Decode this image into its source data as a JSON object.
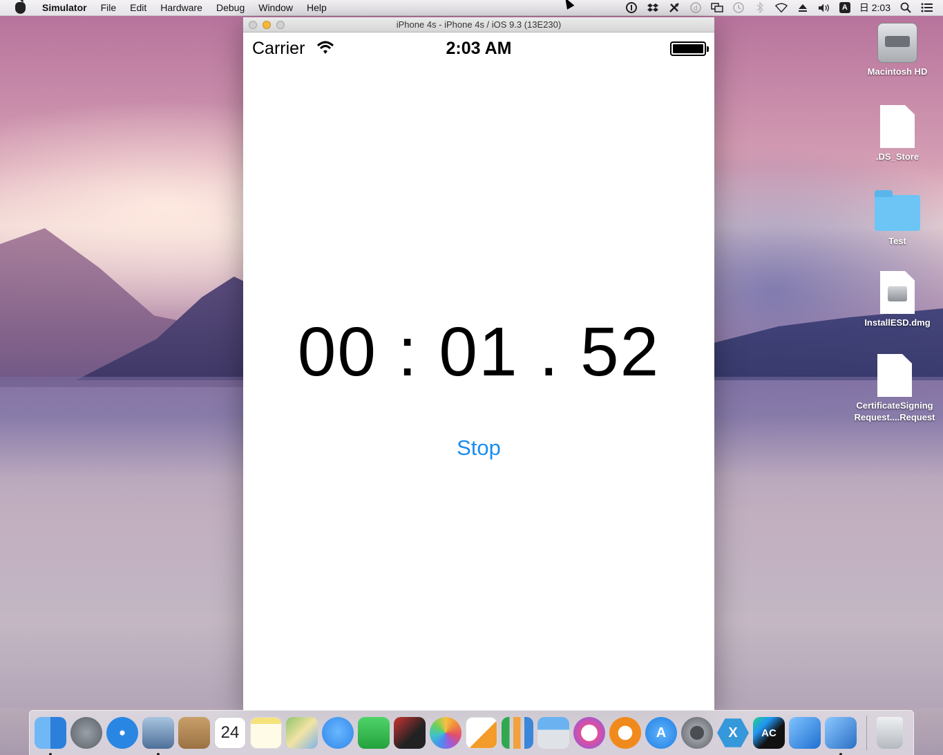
{
  "menubar": {
    "app_name": "Simulator",
    "items": [
      "File",
      "Edit",
      "Hardware",
      "Debug",
      "Window",
      "Help"
    ],
    "input_badge": "A",
    "clock": "日 2:03"
  },
  "simulator": {
    "window_title": "iPhone 4s - iPhone 4s / iOS 9.3 (13E230)"
  },
  "ios": {
    "carrier": "Carrier",
    "time": "2:03 AM",
    "timer": "00 : 01 . 52",
    "stop_label": "Stop"
  },
  "desktop_icons": [
    {
      "label": "Macintosh HD",
      "icon": "hard-drive-icon"
    },
    {
      "label": ".DS_Store",
      "icon": "document-icon"
    },
    {
      "label": "Test",
      "icon": "folder-icon"
    },
    {
      "label": "InstallESD.dmg",
      "icon": "disk-image-icon"
    },
    {
      "label": "CertificateSigning",
      "label2": "Request....Request",
      "icon": "document-icon"
    }
  ],
  "dock": {
    "calendar_day": "24",
    "items": [
      {
        "name": "finder-icon",
        "color": "#3b8ee8",
        "running": true
      },
      {
        "name": "launchpad-icon",
        "color": "#7b7f86",
        "running": false
      },
      {
        "name": "safari-icon",
        "color": "#2a86e3",
        "running": false
      },
      {
        "name": "preview-icon",
        "color": "#6a8db5",
        "running": true
      },
      {
        "name": "contacts-icon",
        "color": "#b98a55",
        "running": false
      },
      {
        "name": "calendar-icon",
        "color": "#ffffff",
        "running": false
      },
      {
        "name": "notes-icon",
        "color": "#f5e27a",
        "running": false
      },
      {
        "name": "maps-icon",
        "color": "#8fc56a",
        "running": false
      },
      {
        "name": "messages-icon",
        "color": "#3f9cf5",
        "running": false
      },
      {
        "name": "facetime-icon",
        "color": "#35b84b",
        "running": false
      },
      {
        "name": "photo-booth-icon",
        "color": "#9b2b2b",
        "running": false
      },
      {
        "name": "photos-icon",
        "color": "#f0a23d",
        "running": false
      },
      {
        "name": "pages-icon",
        "color": "#f39b2b",
        "running": false
      },
      {
        "name": "numbers-icon",
        "color": "#2fa84f",
        "running": false
      },
      {
        "name": "keynote-icon",
        "color": "#3a86d8",
        "running": false
      },
      {
        "name": "itunes-icon",
        "color": "#e14f9a",
        "running": false
      },
      {
        "name": "ibooks-icon",
        "color": "#f08a1d",
        "running": false
      },
      {
        "name": "app-store-icon",
        "color": "#2a8ef0",
        "running": false
      },
      {
        "name": "system-preferences-icon",
        "color": "#6f7278",
        "running": false
      },
      {
        "name": "xamarin-icon",
        "color": "#3498db",
        "running": false
      },
      {
        "name": "appcode-icon",
        "color": "#1d1f24",
        "running": false
      },
      {
        "name": "xcode-icon",
        "color": "#2f8fe0",
        "running": false
      },
      {
        "name": "simulator-icon",
        "color": "#3c88d6",
        "running": true
      }
    ],
    "trash": {
      "name": "trash-icon",
      "color": "#c9ccd1"
    }
  }
}
